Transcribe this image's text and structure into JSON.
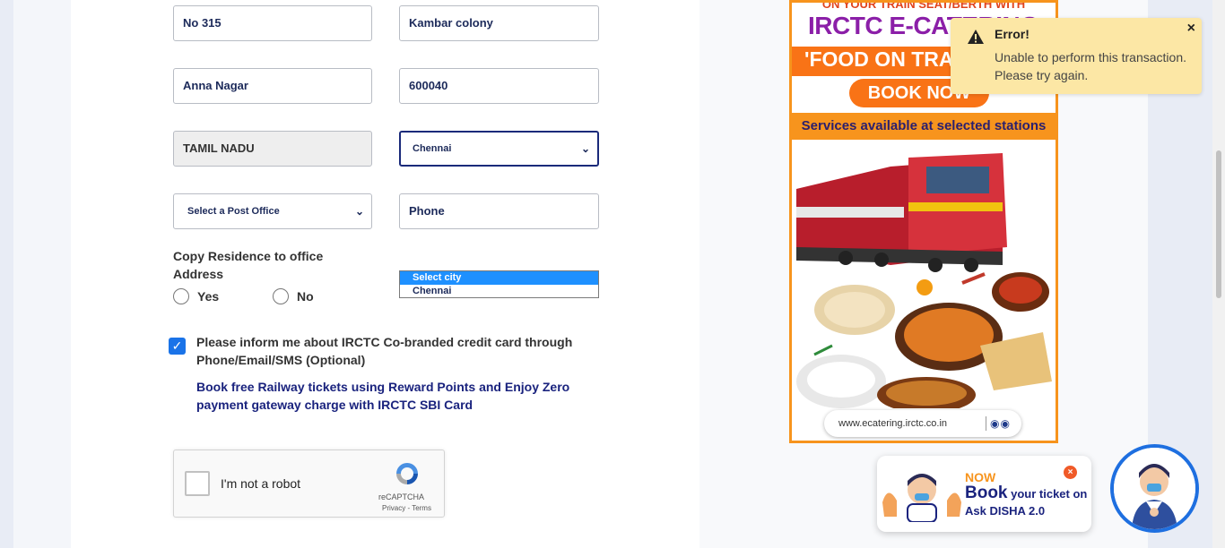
{
  "form": {
    "address1": "No 315",
    "address2": "Kambar colony",
    "area": "Anna Nagar",
    "pincode": "600040",
    "state": "TAMIL NADU",
    "city_selected": "Chennai",
    "post_office_selected": "Select a Post Office",
    "phone_placeholder": "Phone",
    "city_options": [
      "Select city",
      "Chennai"
    ],
    "copy_residence_label": "Copy Residence to office Address",
    "radio_yes": "Yes",
    "radio_no": "No",
    "inform_text": "Please inform me about IRCTC Co-branded credit card through Phone/Email/SMS (Optional)",
    "sbi_text": "Book free Railway tickets using Reward Points and Enjoy Zero payment gateway charge with IRCTC SBI Card"
  },
  "captcha": {
    "label": "I'm not a robot",
    "brand": "reCAPTCHA",
    "terms": "Privacy - Terms"
  },
  "ad": {
    "top_line": "ON YOUR TRAIN SEAT/BERTH WITH",
    "headline": "IRCTC E-CATERING",
    "food_text": "'FOOD ON TRAIN'",
    "book_now": "BOOK NOW",
    "services": "Services available at selected stations",
    "url": "www.ecatering.irctc.co.in"
  },
  "toast": {
    "title": "Error!",
    "message": "Unable to perform this transaction. Please try again.",
    "close": "×"
  },
  "disha": {
    "now": "NOW",
    "book": "Book",
    "your_ticket": " your ticket on",
    "ask": "Ask DISHA 2.0",
    "close": "×"
  },
  "colors": {
    "accent": "#1a73e8",
    "toast_bg": "#fce7a5",
    "ad_orange": "#f7941d",
    "ad_purple": "#8b1fa8",
    "text_navy": "#1a237e"
  }
}
